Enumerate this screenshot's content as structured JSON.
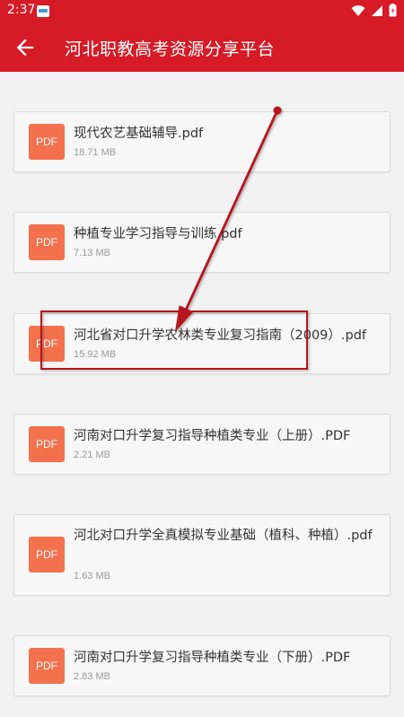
{
  "status_bar": {
    "time": "2:37",
    "icons": [
      "app-notification-icon",
      "wifi-icon",
      "signal-icon",
      "battery-icon"
    ]
  },
  "app_bar": {
    "back_icon": "arrow-left-icon",
    "title": "河北职教高考资源分享平台"
  },
  "files": [
    {
      "icon_label": "PDF",
      "name": "现代农艺基础辅导.pdf",
      "size": "18.71 MB"
    },
    {
      "icon_label": "PDF",
      "name": "种植专业学习指导与训练.pdf",
      "size": "7.13 MB"
    },
    {
      "icon_label": "PDF",
      "name": "河北省对口升学农林类专业复习指南（2009）.pdf",
      "size": "15.92 MB"
    },
    {
      "icon_label": "PDF",
      "name": "河南对口升学复习指导种植类专业（上册）.PDF",
      "size": "2.21 MB"
    },
    {
      "icon_label": "PDF",
      "name": "河北对口升学全真模拟专业基础（植科、种植）.pdf",
      "size": "1.63 MB"
    },
    {
      "icon_label": "PDF",
      "name": "河南对口升学复习指导种植类专业（下册）.PDF",
      "size": "2.83 MB"
    }
  ],
  "colors": {
    "brand_red": "#d61a26",
    "pdf_icon": "#f4714e",
    "annotation": "#b5121b"
  }
}
